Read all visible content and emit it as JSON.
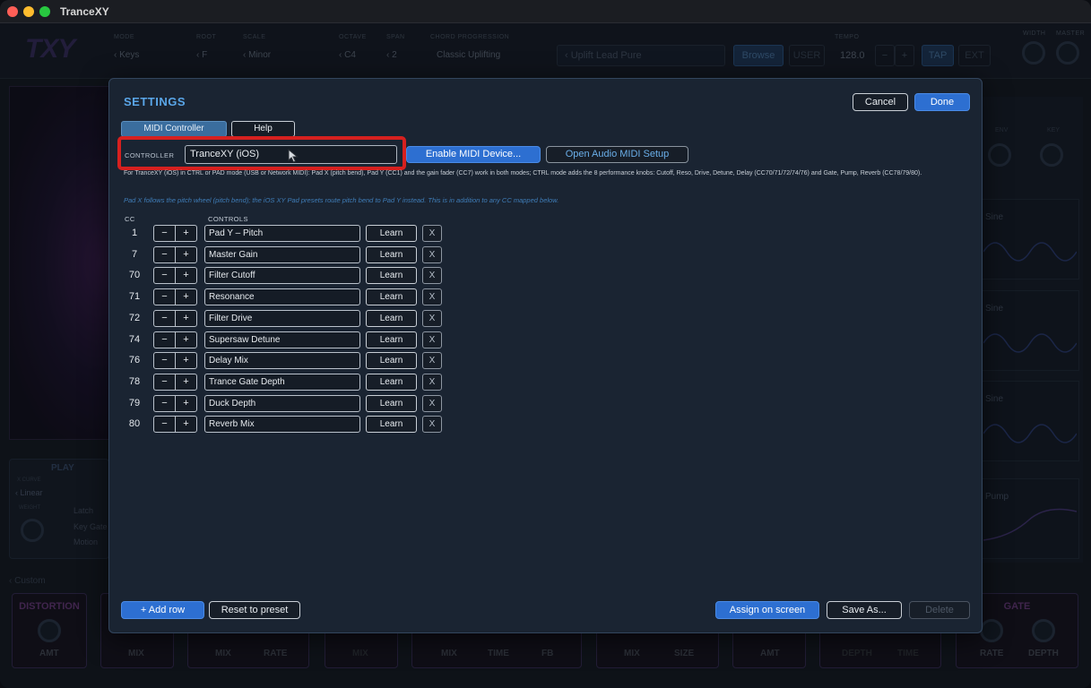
{
  "window": {
    "title": "TranceXY"
  },
  "app": {
    "logo": "TXY",
    "topbar": {
      "mode_label": "MODE",
      "mode_value": "‹ Keys",
      "root_label": "ROOT",
      "root_value": "‹ F",
      "scale_label": "SCALE",
      "scale_value": "‹ Minor",
      "octave_label": "OCTAVE",
      "octave_value": "‹ C4",
      "span_label": "SPAN",
      "span_value": "‹ 2",
      "chord_label": "CHORD PROGRESSION",
      "chord_value": "Classic Uplifting",
      "preset_value": "‹ Uplift Lead Pure",
      "browse_label": "Browse",
      "user_label": "USER",
      "tempo_label": "TEMPO",
      "tempo_value": "128.0",
      "minus_label": "−",
      "plus_label": "+",
      "tap_label": "TAP",
      "ext_label": "EXT",
      "width_label": "WIDTH",
      "master_label": "MASTER"
    },
    "play": {
      "title": "PLAY",
      "curve_label": "X CURVE",
      "curve_value": "‹ Linear",
      "weight_label": "WEIGHT",
      "latch": "Latch",
      "key_gate": "Key Gate",
      "motion": "Motion"
    },
    "custom_label": "‹ Custom",
    "right": {
      "env": "ENV",
      "key": "KEY",
      "wave1": "Sine",
      "wave2": "Sine",
      "wave3": "Sine",
      "pump": "Pump"
    },
    "fx": {
      "distortion": "DISTORTION",
      "amt": "AMT",
      "mix1": "MIX",
      "mix2": "MIX",
      "rate": "RATE",
      "mix3": "MIX",
      "mix4": "MIX",
      "time": "TIME",
      "fb": "FB",
      "mix5": "MIX",
      "size": "SIZE",
      "amt2": "AMT",
      "depth": "DEPTH",
      "time2": "TIME",
      "gate": "GATE",
      "rate2": "RATE",
      "depth2": "DEPTH"
    }
  },
  "settings": {
    "title": "SETTINGS",
    "cancel_label": "Cancel",
    "done_label": "Done",
    "tabs": [
      {
        "label": "MIDI Controller"
      },
      {
        "label": "Help"
      }
    ],
    "controller_label": "CONTROLLER",
    "controller_value": "TranceXY (iOS)",
    "enable_midi_label": "Enable MIDI Device...",
    "open_audio_midi_label": "Open Audio MIDI Setup",
    "help_text": "For TranceXY (iOS) in CTRL or PAD mode (USB or Network MIDI): Pad X (pitch bend), Pad Y (CC1) and the gain fader (CC7) work in both modes; CTRL mode adds the 8 performance knobs: Cutoff, Reso, Drive, Detune, Delay (CC70/71/72/74/76) and Gate, Pump, Reverb (CC78/79/80).",
    "note_text": "Pad X follows the pitch wheel (pitch bend); the iOS XY Pad presets route pitch bend to Pad Y instead. This is in addition to any CC mapped below.",
    "cc_header": "CC",
    "controls_header": "CONTROLS",
    "stepper_minus": "−",
    "stepper_plus": "+",
    "learn_label": "Learn",
    "remove_label": "X",
    "rows": [
      {
        "cc": "1",
        "control": "Pad Y – Pitch"
      },
      {
        "cc": "7",
        "control": "Master Gain"
      },
      {
        "cc": "70",
        "control": "Filter Cutoff"
      },
      {
        "cc": "71",
        "control": "Resonance"
      },
      {
        "cc": "72",
        "control": "Filter Drive"
      },
      {
        "cc": "74",
        "control": "Supersaw Detune"
      },
      {
        "cc": "76",
        "control": "Delay Mix"
      },
      {
        "cc": "78",
        "control": "Trance Gate Depth"
      },
      {
        "cc": "79",
        "control": "Duck Depth"
      },
      {
        "cc": "80",
        "control": "Reverb Mix"
      }
    ],
    "add_row_label": "+ Add row",
    "reset_label": "Reset to preset",
    "assign_label": "Assign on screen",
    "save_as_label": "Save As...",
    "delete_label": "Delete"
  },
  "colors": {
    "accent": "#2d6fd1",
    "title": "#5aa6e8",
    "highlight": "#d6201f"
  }
}
